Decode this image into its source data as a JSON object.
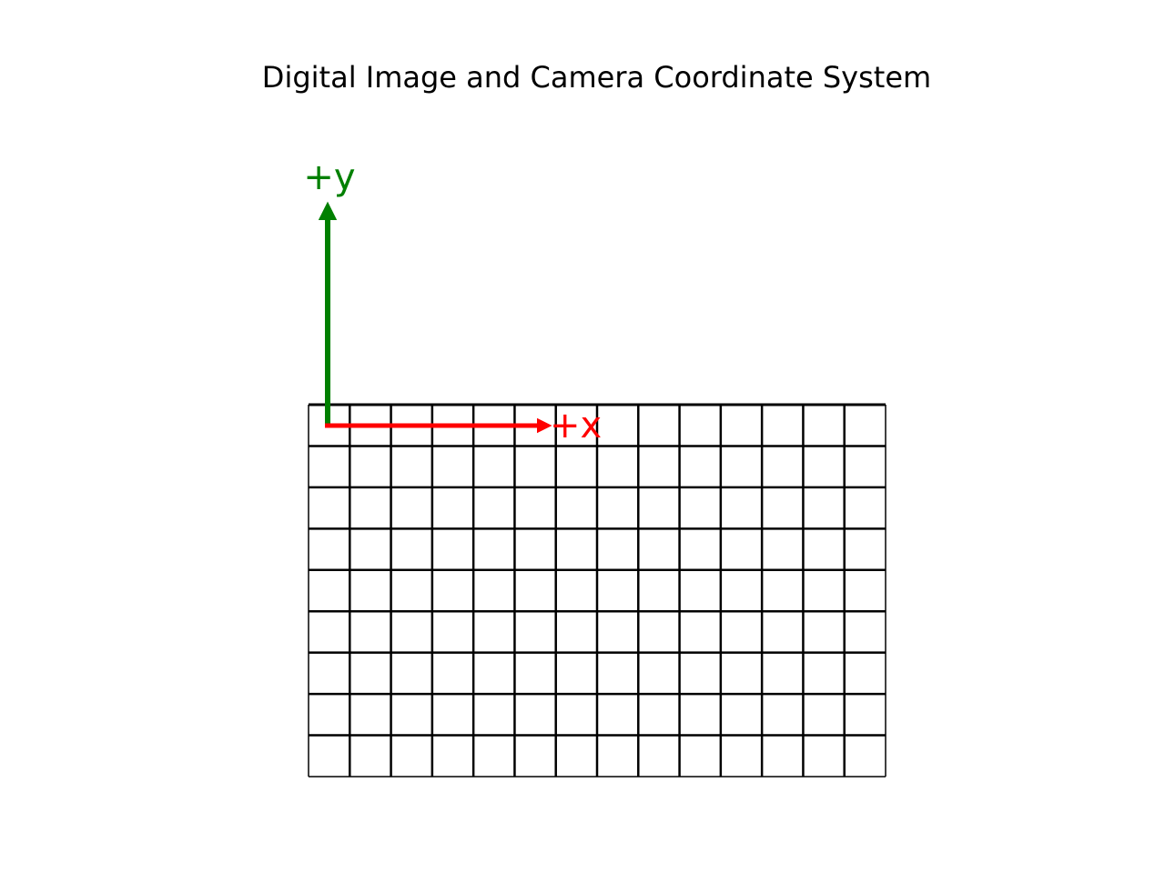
{
  "title": "Digital Image and Camera Coordinate System",
  "grid": {
    "columns": 14,
    "rows": 9
  },
  "axes": {
    "x": {
      "label": "+x",
      "color": "#ff0000"
    },
    "y": {
      "label": "+y",
      "color": "#008000"
    }
  },
  "colors": {
    "grid_line": "#000000",
    "background": "#ffffff"
  }
}
